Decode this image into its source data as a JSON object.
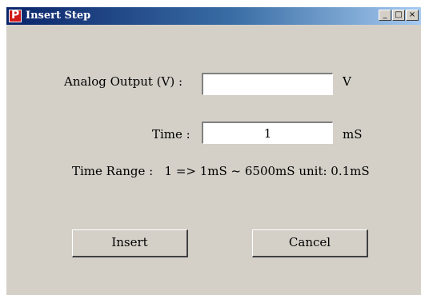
{
  "window": {
    "title": "Insert Step",
    "app_icon_letter": "P",
    "controls": {
      "minimize": "_",
      "maximize": "□",
      "close": "×"
    }
  },
  "form": {
    "analog_output": {
      "label": "Analog Output (V) :",
      "value": "",
      "unit": "V"
    },
    "time": {
      "label": "Time :",
      "value": "1",
      "unit": "mS"
    },
    "time_range": "Time Range :   1 => 1mS ~ 6500mS unit: 0.1mS"
  },
  "buttons": {
    "insert": "Insert",
    "cancel": "Cancel"
  },
  "colors": {
    "dialog_bg": "#d4d0c8",
    "titlebar_start": "#0a246a",
    "titlebar_end": "#a6caf0",
    "app_icon": "#d01818"
  }
}
